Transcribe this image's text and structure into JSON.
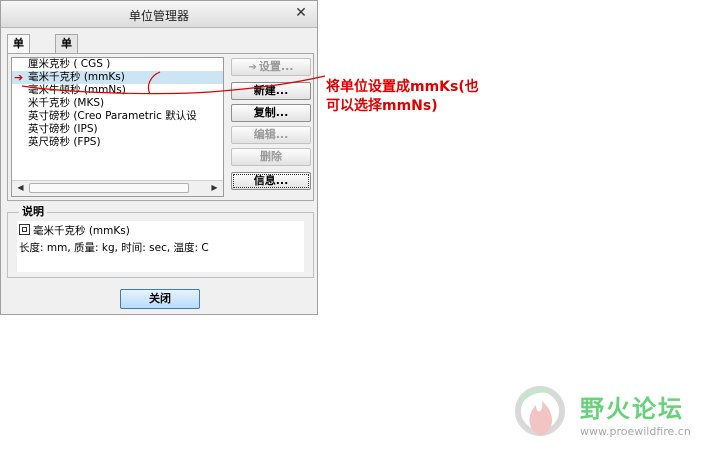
{
  "dialog": {
    "title": "单位管理器",
    "close_symbol": "✕",
    "tabs": [
      {
        "label": "单位制"
      },
      {
        "label": "单位"
      }
    ],
    "unit_systems": [
      {
        "label": "厘米克秒 ( CGS )"
      },
      {
        "label": "毫米千克秒 (mmKs)"
      },
      {
        "label": "毫米牛顿秒 (mmNs)"
      },
      {
        "label": "米千克秒 (MKS)"
      },
      {
        "label": "英寸磅秒 (Creo Parametric 默认设"
      },
      {
        "label": "英寸磅秒 (IPS)"
      },
      {
        "label": "英尺磅秒 (FPS)"
      }
    ],
    "selected_index": 1,
    "selected_marker": "➔",
    "buttons": {
      "set": "设置...",
      "new": "新建...",
      "copy": "复制...",
      "edit": "编辑...",
      "delete": "删除",
      "info": "信息..."
    },
    "scroll": {
      "left": "◀",
      "right": "▶"
    },
    "description": {
      "title": "说明",
      "line1": "毫米千克秒 (mmKs)",
      "line2": "长度: mm, 质量: kg, 时间: sec, 温度: C"
    },
    "close_label": "关闭"
  },
  "annotation": {
    "line1": "将单位设置成mmKs(也",
    "line2": "可以选择mmNs)"
  },
  "watermark": {
    "title": "野火论坛",
    "url": "www.proewildfire.cn"
  }
}
